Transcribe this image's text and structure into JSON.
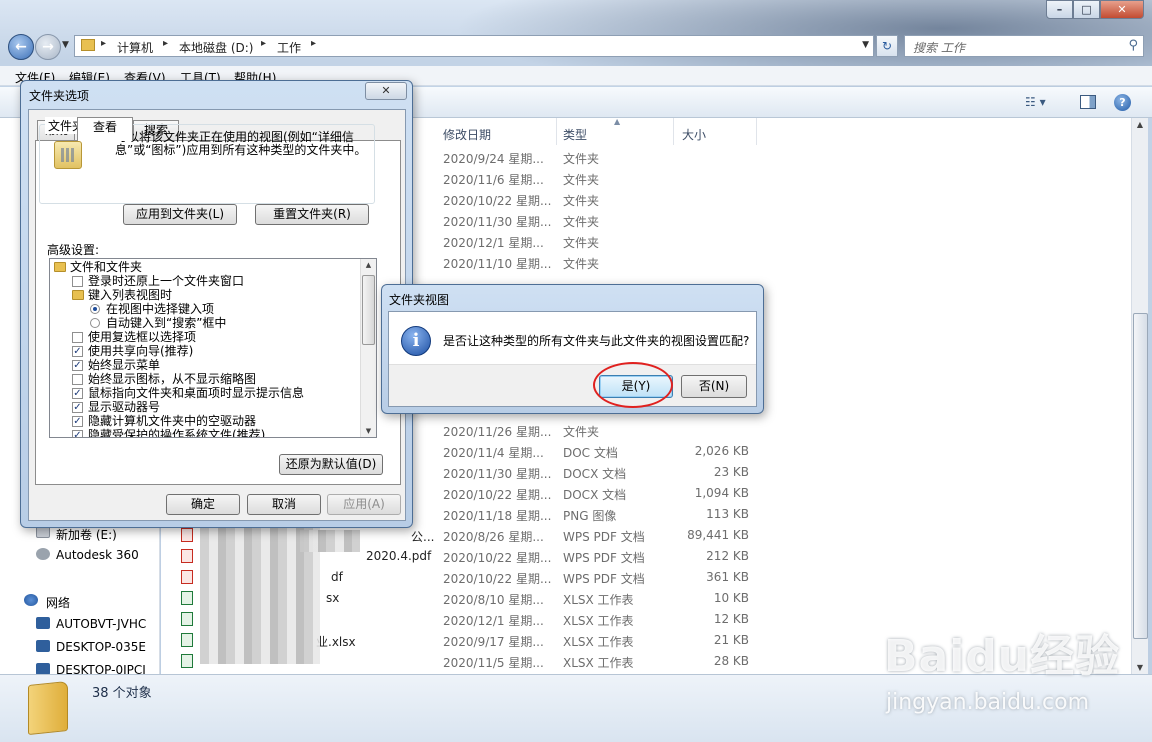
{
  "window": {
    "buttons": {
      "minimize": "–",
      "maximize": "□",
      "close": "✕"
    }
  },
  "address": {
    "crumbs": [
      "计算机",
      "本地磁盘 (D:)",
      "工作"
    ],
    "search_placeholder": "搜索 工作"
  },
  "menubar": [
    "文件(F)",
    "编辑(E)",
    "查看(V)",
    "工具(T)",
    "帮助(H)"
  ],
  "navpane": {
    "items": [
      {
        "label": "新加卷 (E:)",
        "icon": "drive-icon"
      },
      {
        "label": "Autodesk 360",
        "icon": "cloud-icon"
      },
      {
        "label": "网络",
        "icon": "network-icon"
      },
      {
        "label": "AUTOBVT-JVHC",
        "icon": "computer-icon"
      },
      {
        "label": "DESKTOP-035E",
        "icon": "computer-icon"
      },
      {
        "label": "DESKTOP-0IPCI",
        "icon": "computer-icon"
      }
    ]
  },
  "columns": {
    "date": "修改日期",
    "type": "类型",
    "size": "大小"
  },
  "files": [
    {
      "name": "",
      "date": "2020/9/24 星期...",
      "type": "文件夹",
      "size": ""
    },
    {
      "name": "",
      "date": "2020/11/6 星期...",
      "type": "文件夹",
      "size": ""
    },
    {
      "name": "",
      "date": "2020/10/22 星期...",
      "type": "文件夹",
      "size": ""
    },
    {
      "name": "",
      "date": "2020/11/30 星期...",
      "type": "文件夹",
      "size": ""
    },
    {
      "name": "",
      "date": "2020/12/1 星期...",
      "type": "文件夹",
      "size": ""
    },
    {
      "name": "",
      "date": "2020/11/10 星期...",
      "type": "文件夹",
      "size": ""
    },
    {
      "name": "",
      "date": "2020/11/26 星期...",
      "type": "文件夹",
      "size": ""
    },
    {
      "name": "",
      "date": "2020/11/4 星期...",
      "type": "DOC 文档",
      "size": "2,026 KB"
    },
    {
      "name": "",
      "date": "2020/11/30 星期...",
      "type": "DOCX 文档",
      "size": "23 KB"
    },
    {
      "name": "",
      "date": "2020/10/22 星期...",
      "type": "DOCX 文档",
      "size": "1,094 KB"
    },
    {
      "name": "",
      "date": "2020/11/18 星期...",
      "type": "PNG 图像",
      "size": "113 KB"
    },
    {
      "name": "公...",
      "date": "2020/8/26 星期...",
      "type": "WPS PDF 文档",
      "size": "89,441 KB"
    },
    {
      "name": "2020.4.pdf",
      "date": "2020/10/22 星期...",
      "type": "WPS PDF 文档",
      "size": "212 KB"
    },
    {
      "name": "df",
      "date": "2020/10/22 星期...",
      "type": "WPS PDF 文档",
      "size": "361 KB"
    },
    {
      "name": "sx",
      "date": "2020/8/10 星期...",
      "type": "XLSX 工作表",
      "size": "10 KB"
    },
    {
      "name": "",
      "date": "2020/12/1 星期...",
      "type": "XLSX 工作表",
      "size": "12 KB"
    },
    {
      "name": "业.xlsx",
      "date": "2020/9/17 星期...",
      "type": "XLSX 工作表",
      "size": "21 KB"
    },
    {
      "name": "",
      "date": "2020/11/5 星期...",
      "type": "XLSX 工作表",
      "size": "28 KB"
    }
  ],
  "status": {
    "count": "38 个对象"
  },
  "watermark": {
    "brand": "Baidu经验",
    "url": "jingyan.baidu.com"
  },
  "folder_options": {
    "title": "文件夹选项",
    "close": "✕",
    "tabs": [
      "常规",
      "查看",
      "搜索"
    ],
    "group_title": "文件夹视图",
    "group_desc": "可以将该文件夹正在使用的视图(例如“详细信息”或“图标”)应用到所有这种类型的文件夹中。",
    "apply_btn": "应用到文件夹(L)",
    "reset_btn": "重置文件夹(R)",
    "advanced_label": "高级设置:",
    "tree": [
      {
        "kind": "folder",
        "label": "文件和文件夹",
        "indent": 0
      },
      {
        "kind": "check",
        "checked": false,
        "label": "登录时还原上一个文件夹窗口",
        "indent": 1
      },
      {
        "kind": "folder",
        "label": "键入列表视图时",
        "indent": 1
      },
      {
        "kind": "radio",
        "checked": true,
        "label": "在视图中选择键入项",
        "indent": 2
      },
      {
        "kind": "radio",
        "checked": false,
        "label": "自动键入到“搜索”框中",
        "indent": 2
      },
      {
        "kind": "check",
        "checked": false,
        "label": "使用复选框以选择项",
        "indent": 1
      },
      {
        "kind": "check",
        "checked": true,
        "label": "使用共享向导(推荐)",
        "indent": 1
      },
      {
        "kind": "check",
        "checked": true,
        "label": "始终显示菜单",
        "indent": 1
      },
      {
        "kind": "check",
        "checked": false,
        "label": "始终显示图标，从不显示缩略图",
        "indent": 1
      },
      {
        "kind": "check",
        "checked": true,
        "label": "鼠标指向文件夹和桌面项时显示提示信息",
        "indent": 1
      },
      {
        "kind": "check",
        "checked": true,
        "label": "显示驱动器号",
        "indent": 1
      },
      {
        "kind": "check",
        "checked": true,
        "label": "隐藏计算机文件夹中的空驱动器",
        "indent": 1
      },
      {
        "kind": "check",
        "checked": true,
        "label": "隐藏受保护的操作系统文件(推荐)",
        "indent": 1
      }
    ],
    "restore_btn": "还原为默认值(D)",
    "ok_btn": "确定",
    "cancel_btn": "取消",
    "apply_disabled_btn": "应用(A)"
  },
  "confirm": {
    "title": "文件夹视图",
    "message": "是否让这种类型的所有文件夹与此文件夹的视图设置匹配?",
    "yes": "是(Y)",
    "no": "否(N)"
  },
  "colors": {
    "accent": "#3d71b8",
    "highlight_ring": "#e0211f"
  }
}
